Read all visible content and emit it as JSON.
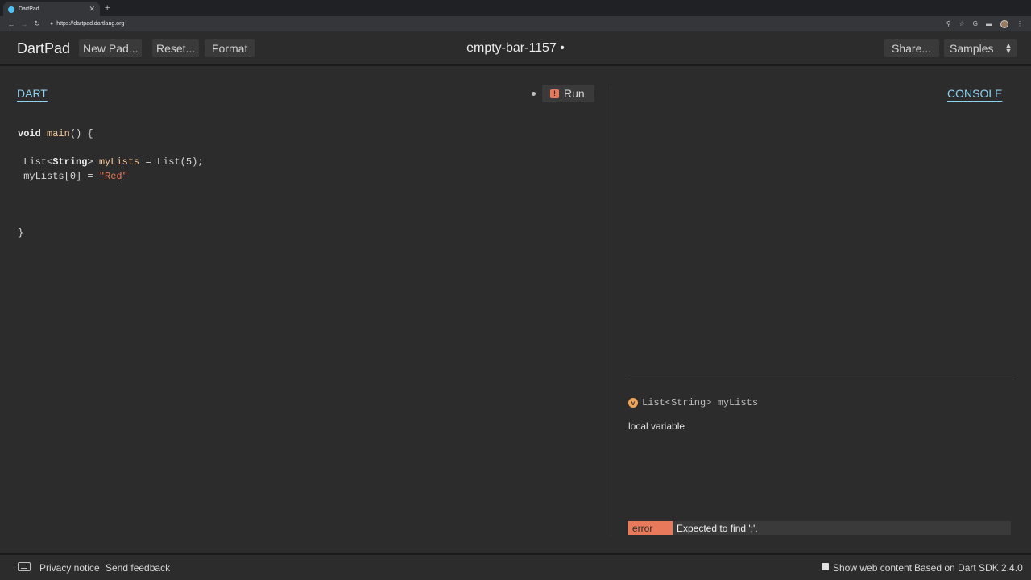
{
  "browser": {
    "tab_title": "DartPad",
    "tab_close": "✕",
    "new_tab": "+",
    "url": "https://dartpad.dartlang.org"
  },
  "appbar": {
    "brand": "DartPad",
    "new_pad": "New Pad...",
    "reset": "Reset...",
    "format": "Format",
    "pad_title": "empty-bar-1157 •",
    "share": "Share...",
    "samples": "Samples"
  },
  "editor": {
    "label": "DART",
    "run": "Run",
    "code": {
      "l1_kw": "void",
      "l1_fn": "main",
      "l1_rest": "() {",
      "l3_type": "List<",
      "l3_generic": "String",
      "l3_type_end": ">",
      "l3_var": "myLists",
      "l3_rest": " = List(5);",
      "l4_var": "myLists[0] = ",
      "l4_str": "\"Red",
      "l4_str_end": "\"",
      "l7": "}"
    }
  },
  "console": {
    "label": "CONSOLE"
  },
  "docs": {
    "icon_letter": "v",
    "signature": "List<String> myLists",
    "description": "local variable"
  },
  "issue": {
    "kind": "error",
    "message": "Expected to find ';'."
  },
  "footer": {
    "privacy": "Privacy notice",
    "feedback": "Send feedback",
    "show_web": "Show web content",
    "sdk": "Based on Dart SDK 2.4.0"
  },
  "colors": {
    "accent_link": "#8ed1ef",
    "error": "#e8795a",
    "identifier": "#f2c79b"
  }
}
